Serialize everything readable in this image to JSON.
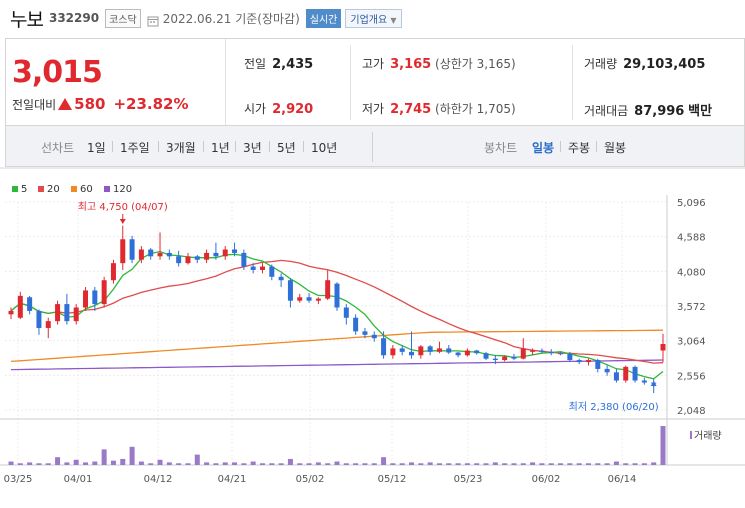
{
  "header": {
    "stock_name": "누보",
    "stock_code": "332290",
    "market": "코스닥",
    "date": "2022.06.21 기준(장마감)",
    "realtime_label": "실시간",
    "company_label": "기업개요"
  },
  "quote": {
    "current_price": "3,015",
    "diff_label": "전일대비",
    "diff_value": "580",
    "diff_pct": "+23.82%",
    "prev_close_label": "전일",
    "prev_close": "2,435",
    "open_label": "시가",
    "open": "2,920",
    "high_label": "고가",
    "high": "3,165",
    "upper_limit_text": "(상한가 3,165)",
    "low_label": "저가",
    "low": "2,745",
    "lower_limit_text": "(하한가 1,705)",
    "volume_label": "거래량",
    "volume": "29,103,405",
    "amount_label": "거래대금",
    "amount": "87,996",
    "amount_unit": "백만"
  },
  "toolbar": {
    "line_label": "선차트",
    "periods": [
      "1일",
      "1주일",
      "3개월",
      "1년",
      "3년",
      "5년",
      "10년"
    ],
    "candle_label": "봉차트",
    "candle_periods": [
      "일봉",
      "주봉",
      "월봉"
    ],
    "active_candle": "일봉"
  },
  "chart_data": {
    "type": "line",
    "legend": [
      {
        "name": "5",
        "color": "#2db839"
      },
      {
        "name": "20",
        "color": "#e14b4b"
      },
      {
        "name": "60",
        "color": "#f08a24"
      },
      {
        "name": "120",
        "color": "#8c5ac8"
      }
    ],
    "y_ticks": [
      "5,096",
      "4,588",
      "4,080",
      "3,572",
      "3,064",
      "2,556",
      "2,048"
    ],
    "ylim": [
      2048,
      5096
    ],
    "x_ticks": [
      "03/25",
      "04/01",
      "04/12",
      "04/21",
      "05/02",
      "05/12",
      "05/23",
      "06/02",
      "06/14"
    ],
    "annotations": {
      "high": "최고 4,750 (04/07)",
      "low": "최저 2,380 (06/20)"
    },
    "volume_label": "거래량",
    "candles": [
      [
        3450,
        3550,
        3380,
        3500
      ],
      [
        3400,
        3780,
        3380,
        3720
      ],
      [
        3700,
        3720,
        3450,
        3500
      ],
      [
        3500,
        3520,
        3150,
        3250
      ],
      [
        3250,
        3400,
        3100,
        3350
      ],
      [
        3350,
        3650,
        3300,
        3600
      ],
      [
        3600,
        3750,
        3300,
        3350
      ],
      [
        3350,
        3600,
        3300,
        3550
      ],
      [
        3550,
        3850,
        3500,
        3800
      ],
      [
        3800,
        3850,
        3500,
        3600
      ],
      [
        3600,
        4000,
        3550,
        3950
      ],
      [
        3950,
        4250,
        3900,
        4200
      ],
      [
        4200,
        4750,
        4100,
        4550
      ],
      [
        4550,
        4600,
        4200,
        4250
      ],
      [
        4250,
        4450,
        4200,
        4400
      ],
      [
        4400,
        4420,
        4250,
        4300
      ],
      [
        4300,
        4650,
        4250,
        4350
      ],
      [
        4350,
        4400,
        4250,
        4300
      ],
      [
        4300,
        4380,
        4150,
        4200
      ],
      [
        4200,
        4350,
        4180,
        4300
      ],
      [
        4300,
        4320,
        4200,
        4250
      ],
      [
        4250,
        4400,
        4200,
        4350
      ],
      [
        4350,
        4500,
        4250,
        4300
      ],
      [
        4300,
        4450,
        4250,
        4400
      ],
      [
        4400,
        4500,
        4300,
        4350
      ],
      [
        4350,
        4400,
        4100,
        4150
      ],
      [
        4150,
        4200,
        4050,
        4100
      ],
      [
        4100,
        4200,
        4050,
        4150
      ],
      [
        4150,
        4180,
        3950,
        4000
      ],
      [
        4000,
        4050,
        3850,
        3950
      ],
      [
        3950,
        3980,
        3550,
        3650
      ],
      [
        3650,
        3750,
        3620,
        3700
      ],
      [
        3700,
        3760,
        3620,
        3650
      ],
      [
        3650,
        3700,
        3600,
        3680
      ],
      [
        3680,
        4100,
        3660,
        3950
      ],
      [
        3900,
        3920,
        3500,
        3550
      ],
      [
        3550,
        3600,
        3300,
        3400
      ],
      [
        3400,
        3450,
        3150,
        3200
      ],
      [
        3200,
        3250,
        3100,
        3150
      ],
      [
        3150,
        3200,
        3050,
        3100
      ],
      [
        3100,
        3200,
        2800,
        2850
      ],
      [
        2850,
        3000,
        2800,
        2950
      ],
      [
        2950,
        3000,
        2850,
        2900
      ],
      [
        2900,
        3200,
        2800,
        2850
      ],
      [
        2850,
        3000,
        2800,
        2980
      ],
      [
        2980,
        3000,
        2850,
        2900
      ],
      [
        2900,
        3050,
        2880,
        2950
      ],
      [
        2950,
        3000,
        2870,
        2890
      ],
      [
        2890,
        2900,
        2820,
        2850
      ],
      [
        2850,
        2950,
        2830,
        2920
      ],
      [
        2920,
        2930,
        2860,
        2880
      ],
      [
        2880,
        2900,
        2780,
        2800
      ],
      [
        2800,
        2850,
        2720,
        2780
      ],
      [
        2780,
        2850,
        2760,
        2830
      ],
      [
        2830,
        2870,
        2780,
        2800
      ],
      [
        2800,
        3100,
        2790,
        2950
      ],
      [
        2900,
        2950,
        2850,
        2920
      ],
      [
        2920,
        2950,
        2880,
        2900
      ],
      [
        2900,
        2940,
        2850,
        2880
      ],
      [
        2880,
        2900,
        2850,
        2870
      ],
      [
        2870,
        2900,
        2750,
        2780
      ],
      [
        2780,
        2800,
        2720,
        2750
      ],
      [
        2750,
        2800,
        2700,
        2780
      ],
      [
        2780,
        2800,
        2600,
        2650
      ],
      [
        2650,
        2700,
        2550,
        2600
      ],
      [
        2600,
        2650,
        2450,
        2480
      ],
      [
        2480,
        2700,
        2450,
        2680
      ],
      [
        2680,
        2700,
        2450,
        2480
      ],
      [
        2480,
        2520,
        2420,
        2450
      ],
      [
        2450,
        2500,
        2380,
        2435
      ],
      [
        2920,
        3165,
        2745,
        3015
      ]
    ],
    "volumes": [
      4,
      2,
      3,
      2,
      2,
      9,
      3,
      6,
      3,
      4,
      18,
      5,
      7,
      21,
      4,
      2,
      6,
      3,
      2,
      2,
      12,
      3,
      2,
      3,
      3,
      2,
      4,
      2,
      2,
      2,
      7,
      2,
      2,
      3,
      2,
      4,
      2,
      2,
      2,
      2,
      9,
      2,
      2,
      3,
      2,
      3,
      2,
      2,
      2,
      2,
      2,
      2,
      3,
      2,
      2,
      2,
      3,
      2,
      2,
      2,
      2,
      2,
      2,
      2,
      2,
      4,
      2,
      2,
      2,
      3,
      45
    ]
  }
}
